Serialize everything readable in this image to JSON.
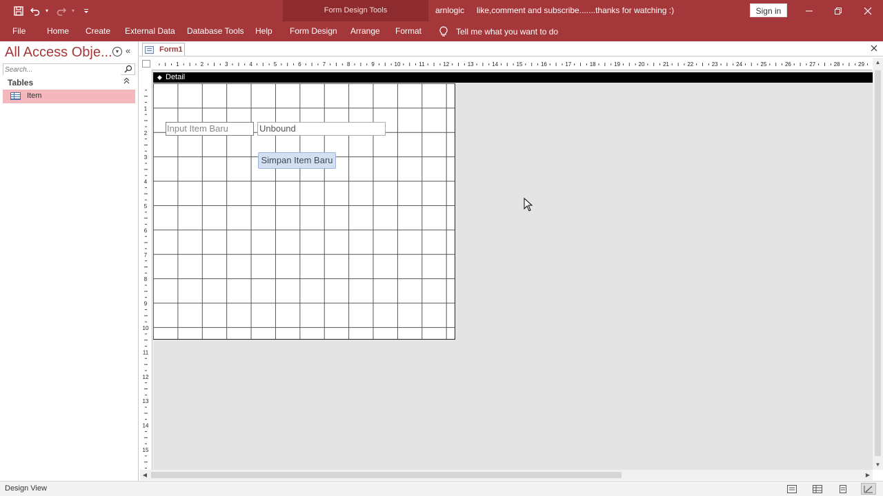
{
  "title_bar": {
    "tools_context": "Form Design Tools",
    "app_user": "arnlogic",
    "caption": "like,comment and subscribe.......thanks for watching  :)",
    "sign_in": "Sign in"
  },
  "ribbon": {
    "tabs": [
      "File",
      "Home",
      "Create",
      "External Data",
      "Database Tools",
      "Help",
      "Form Design",
      "Arrange",
      "Format"
    ],
    "tell_me": "Tell me what you want to do"
  },
  "nav_pane": {
    "title": "All Access Obje...",
    "search_placeholder": "Search...",
    "group": "Tables",
    "items": [
      {
        "label": "Item"
      }
    ]
  },
  "document": {
    "tab": "Form1",
    "section": "Detail",
    "controls": {
      "label": "Input Item Baru",
      "textbox": "Unbound",
      "button": "Simpan Item Baru"
    }
  },
  "rulers": {
    "horizontal_ticks": [
      "1",
      "2",
      "3",
      "4",
      "5",
      "6",
      "7",
      "8",
      "9",
      "10",
      "11",
      "12",
      "13",
      "14",
      "15",
      "16",
      "17",
      "18",
      "19",
      "20",
      "21",
      "22",
      "23",
      "24",
      "25",
      "26",
      "27",
      "28",
      "29"
    ],
    "vertical_ticks": [
      "1",
      "2",
      "3",
      "4",
      "5",
      "6",
      "7",
      "8",
      "9",
      "10",
      "11",
      "12",
      "13",
      "14",
      "15"
    ]
  },
  "status_bar": {
    "view": "Design View"
  },
  "colors": {
    "brand": "#a4373a",
    "selected_item": "#f3b7bd"
  }
}
